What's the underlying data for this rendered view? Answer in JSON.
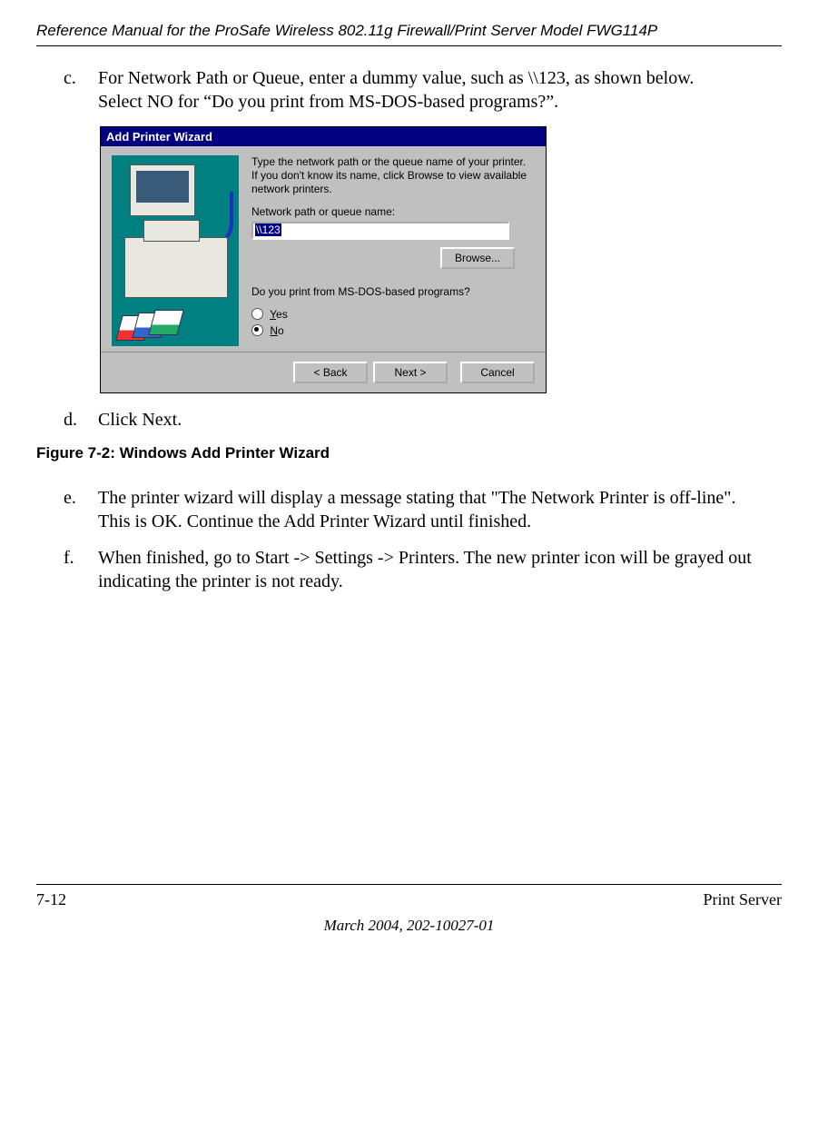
{
  "header": {
    "running_title": "Reference Manual for the ProSafe Wireless 802.11g  Firewall/Print Server Model FWG114P"
  },
  "steps": {
    "c": {
      "marker": "c.",
      "text_line1": "For Network Path or Queue, enter a dummy value, such as \\\\123, as shown below.",
      "text_line2": "Select NO for “Do you print from MS-DOS-based programs?”."
    },
    "d": {
      "marker": "d.",
      "text": "Click Next."
    },
    "e": {
      "marker": "e.",
      "text_line1": "The printer wizard will display a message stating that \"The Network Printer is off-line\".",
      "text_line2": "This is OK. Continue the Add Printer Wizard until finished."
    },
    "f": {
      "marker": "f.",
      "text_line1": "When finished, go to Start -> Settings -> Printers. The new printer icon will be grayed out",
      "text_line2": "indicating the printer is not ready."
    }
  },
  "wizard": {
    "title": "Add Printer Wizard",
    "instruction": "Type the network path or the queue name of your printer. If you don't know its name, click Browse to view available network printers.",
    "queue_label": "Network path or queue name:",
    "queue_value": "\\\\123",
    "browse_label": "Browse...",
    "dos_question": "Do you print from MS-DOS-based programs?",
    "yes_label": "Yes",
    "no_label": "No",
    "back_label": "< Back",
    "next_label": "Next >",
    "cancel_label": "Cancel"
  },
  "figure_caption": "Figure 7-2:  Windows Add Printer Wizard",
  "footer": {
    "page_number": "7-12",
    "section": "Print Server",
    "date_doc": "March 2004, 202-10027-01"
  }
}
